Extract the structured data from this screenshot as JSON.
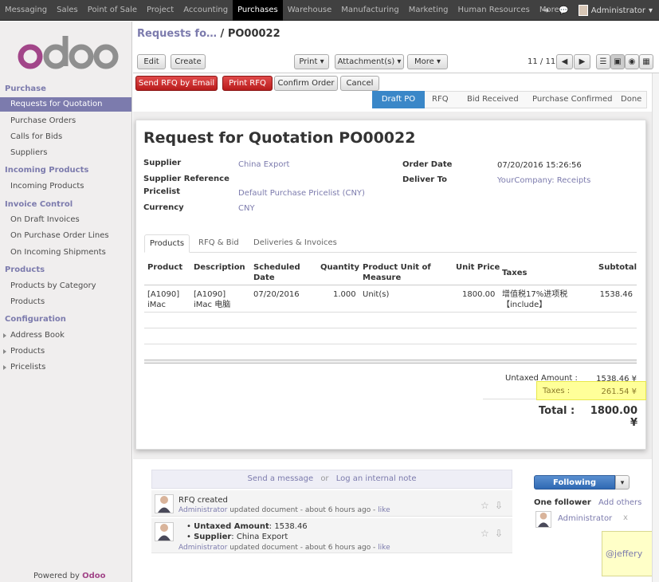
{
  "topnav": {
    "items": [
      "Messaging",
      "Sales",
      "Point of Sale",
      "Project",
      "Accounting",
      "Purchases",
      "Warehouse",
      "Manufacturing",
      "Marketing",
      "Human Resources",
      "More"
    ],
    "active": "Purchases",
    "user": "Administrator"
  },
  "sidebar": {
    "logo": "odoo",
    "sections": [
      {
        "title": "Purchase",
        "items": [
          "Requests for Quotation",
          "Purchase Orders",
          "Calls for Bids",
          "Suppliers"
        ]
      },
      {
        "title": "Incoming Products",
        "items": [
          "Incoming Products"
        ]
      },
      {
        "title": "Invoice Control",
        "items": [
          "On Draft Invoices",
          "On Purchase Order Lines",
          "On Incoming Shipments"
        ]
      },
      {
        "title": "Products",
        "items": [
          "Products by Category",
          "Products"
        ]
      },
      {
        "title": "Configuration",
        "items": [
          "Address Book",
          "Products",
          "Pricelists"
        ]
      }
    ],
    "powered_prefix": "Powered by ",
    "powered_brand": "Odoo"
  },
  "breadcrumb": {
    "parent": "Requests fo…",
    "sep": "/",
    "current": "PO00022"
  },
  "toolbar": {
    "edit": "Edit",
    "create": "Create",
    "print": "Print",
    "attachments": "Attachment(s)",
    "more": "More",
    "pager": "11 / 11"
  },
  "actions": {
    "send_rfq": "Send RFQ by Email",
    "print_rfq": "Print RFQ",
    "confirm": "Confirm Order",
    "cancel": "Cancel"
  },
  "statusbar": [
    "Draft PO",
    "RFQ",
    "Bid Received",
    "Purchase Confirmed",
    "Done"
  ],
  "form": {
    "title_prefix": "Request for Quotation ",
    "title_number": "PO00022",
    "supplier_label": "Supplier",
    "supplier": "China Export",
    "supplier_ref_label": "Supplier Reference",
    "pricelist_label": "Pricelist",
    "pricelist": "Default Purchase Pricelist (CNY)",
    "currency_label": "Currency",
    "currency": "CNY",
    "order_date_label": "Order Date",
    "order_date": "07/20/2016 15:26:56",
    "deliver_to_label": "Deliver To",
    "deliver_to": "YourCompany: Receipts"
  },
  "tabs": [
    "Products",
    "RFQ & Bid",
    "Deliveries & Invoices"
  ],
  "lines": {
    "headers": [
      "Product",
      "Description",
      "Scheduled Date",
      "Quantity",
      "Product Unit of Measure",
      "Unit Price",
      "Taxes",
      "Subtotal"
    ],
    "row": {
      "product": "[A1090] iMac",
      "description": "[A1090] iMac 电脑",
      "date": "07/20/2016",
      "qty": "1.000",
      "uom": "Unit(s)",
      "price": "1800.00",
      "taxes": "增值税17%进项税【include】",
      "subtotal": "1538.46"
    }
  },
  "totals": {
    "untaxed_label": "Untaxed Amount :",
    "untaxed": "1538.46 ¥",
    "taxes_label": "Taxes :",
    "taxes": "261.54 ¥",
    "total_label": "Total :",
    "total": "1800.00 ¥",
    "highlight_color": "#ffff99"
  },
  "chatter": {
    "send_message": "Send a message",
    "or": "or",
    "log_note": "Log an internal note",
    "msg1_title": "RFQ created",
    "msg1_author": "Administrator",
    "msg1_text": " updated document - about 6 hours ago - ",
    "msg1_like": "like",
    "msg2_line1_label": "Untaxed Amount",
    "msg2_line1_value": ": 1538.46",
    "msg2_line2_label": "Supplier",
    "msg2_line2_value": ": China Export",
    "msg2_author": "Administrator",
    "msg2_text": " updated document - about 6 hours ago - ",
    "msg2_like": "like",
    "following": "Following",
    "followers": "One follower",
    "add_others": "Add others",
    "follower_name": "Administrator",
    "remove": "x"
  },
  "sticky": {
    "text": "@jeffery"
  }
}
